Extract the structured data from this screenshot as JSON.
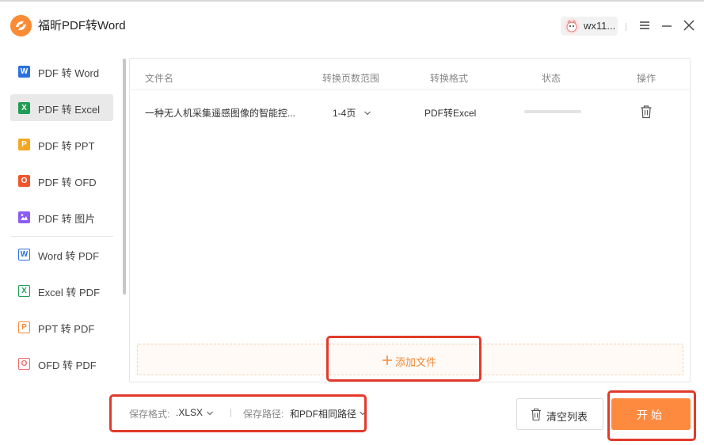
{
  "app": {
    "title": "福昕PDF转Word",
    "user_name": "wx11..."
  },
  "sidebar": {
    "items": [
      {
        "label": "PDF 转 Word",
        "icon": "word-icon",
        "glyph": "W",
        "color": "#2b6fe0",
        "active": false
      },
      {
        "label": "PDF 转 Excel",
        "icon": "excel-icon",
        "glyph": "X",
        "color": "#1f9d55",
        "active": true
      },
      {
        "label": "PDF 转 PPT",
        "icon": "ppt-icon",
        "glyph": "P",
        "color": "#f5a623",
        "active": false
      },
      {
        "label": "PDF 转 OFD",
        "icon": "ofd-icon",
        "glyph": "O",
        "color": "#f0562d",
        "active": false
      },
      {
        "label": "PDF 转 图片",
        "icon": "image-icon",
        "glyph": "▣",
        "color": "#8b5cf6",
        "active": false
      },
      {
        "label": "Word 转 PDF",
        "icon": "word-to-pdf-icon",
        "glyph": "W",
        "color": "#2b6fe0",
        "active": false
      },
      {
        "label": "Excel 转 PDF",
        "icon": "excel-to-pdf-icon",
        "glyph": "X",
        "color": "#1f9d55",
        "active": false
      },
      {
        "label": "PPT 转 PDF",
        "icon": "ppt-to-pdf-icon",
        "glyph": "P",
        "color": "#f5883b",
        "active": false
      },
      {
        "label": "OFD 转 PDF",
        "icon": "ofd-to-pdf-icon",
        "glyph": "O",
        "color": "#f06a6a",
        "active": false
      }
    ]
  },
  "table": {
    "headers": {
      "filename": "文件名",
      "page_range": "转换页数范围",
      "format": "转换格式",
      "status": "状态",
      "action": "操作"
    },
    "rows": [
      {
        "filename": "一种无人机采集遥感图像的智能控...",
        "page_range": "1-4页",
        "format": "PDF转Excel",
        "progress": 0
      }
    ]
  },
  "add_file": {
    "label": "添加文件"
  },
  "bottom": {
    "format_label": "保存格式:",
    "format_value": ".XLSX",
    "path_label": "保存路径:",
    "path_value": "和PDF相同路径",
    "clear_label": "清空列表",
    "start_label": "开始"
  },
  "colors": {
    "accent": "#fd8a3e",
    "highlight": "#e23a2a"
  }
}
